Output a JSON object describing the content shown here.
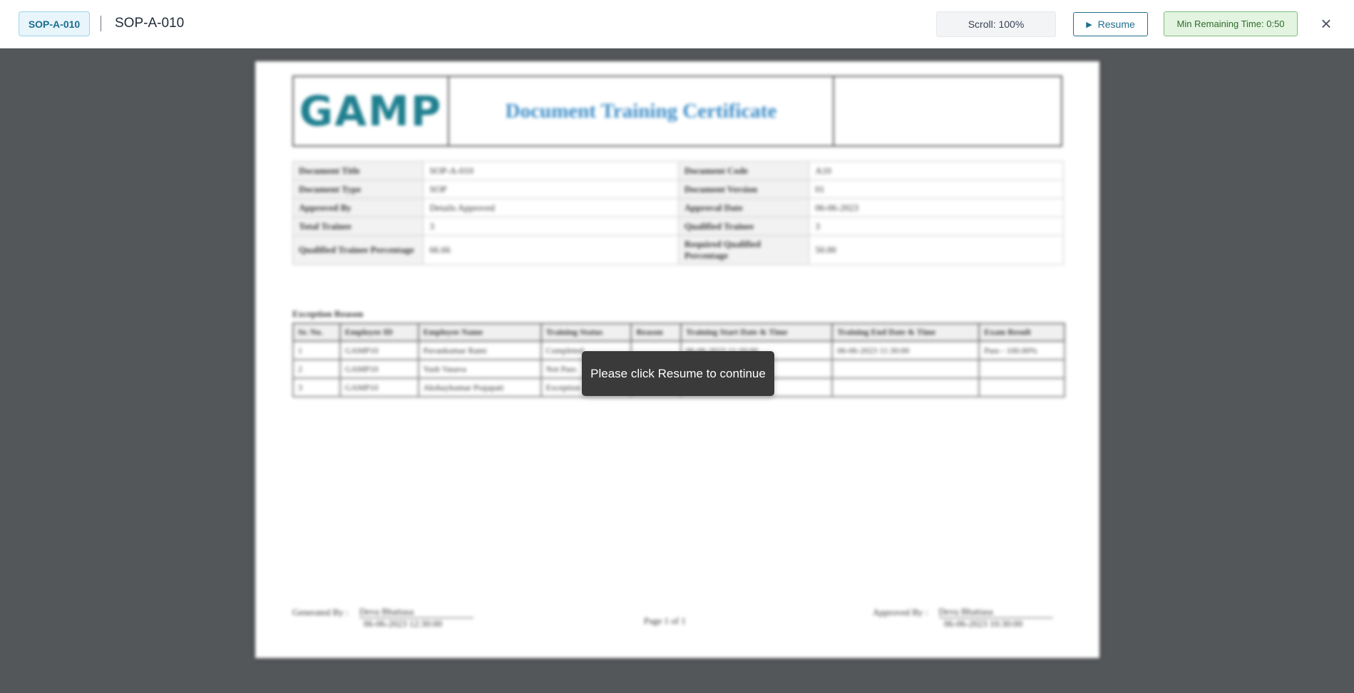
{
  "header": {
    "doc_badge": "SOP-A-010",
    "doc_title": "SOP-A-010",
    "scroll_indicator": "Scroll: 100%",
    "resume_label": "Resume",
    "min_remaining_time": "Min Remaining Time: 0:50",
    "close_icon": "close-icon",
    "play_icon": "play-icon"
  },
  "document": {
    "logo_text": "GAMP",
    "title": "Document Training Certificate",
    "info_rows": [
      {
        "l1": "Document Title",
        "v1": "SOP-A-010",
        "l2": "Document Code",
        "v2": "A10"
      },
      {
        "l1": "Document Type",
        "v1": "SOP",
        "l2": "Document Version",
        "v2": "01"
      },
      {
        "l1": "Approved By",
        "v1": "Details Approved",
        "l2": "Approval Date",
        "v2": "06-06-2023"
      },
      {
        "l1": "Total Trainee",
        "v1": "3",
        "l2": "Qualified Trainee",
        "v2": "3"
      },
      {
        "l1": "Qualified Trainee Percentage",
        "v1": "66.66",
        "l2": "Required Qualified Percentage",
        "v2": "50.00"
      }
    ],
    "exception_caption": "Exception Reason",
    "exception_headers": [
      "Sr. No.",
      "Employee ID",
      "Employee Name",
      "Training Status",
      "Reason",
      "Training Start Date & Time",
      "Training End Date & Time",
      "Exam Result"
    ],
    "exception_rows": [
      [
        "1",
        "GAMP10",
        "Pavankumar Rami",
        "Completed",
        "",
        "06-06-2023 11:20:00",
        "06-06-2023 11:30:00",
        "Pass - 100.00%"
      ],
      [
        "2",
        "GAMP10",
        "Yash Vasava",
        "Not Pass",
        "",
        "",
        "",
        ""
      ],
      [
        "3",
        "GAMP10",
        "Akshaykumar Prajapati",
        "Exception",
        "",
        "",
        "",
        ""
      ]
    ],
    "footer": {
      "generated_label": "Generated By :",
      "generated_name": "Devu Bhattasa",
      "generated_date": "06-06-2023 12:30:00",
      "page_label": "Page 1 of 1",
      "approved_label": "Approved By :",
      "approved_name": "Devu Bhattasa",
      "approved_date": "06-06-2023 10:30:00"
    }
  },
  "toast": {
    "message": "Please click Resume to continue"
  }
}
